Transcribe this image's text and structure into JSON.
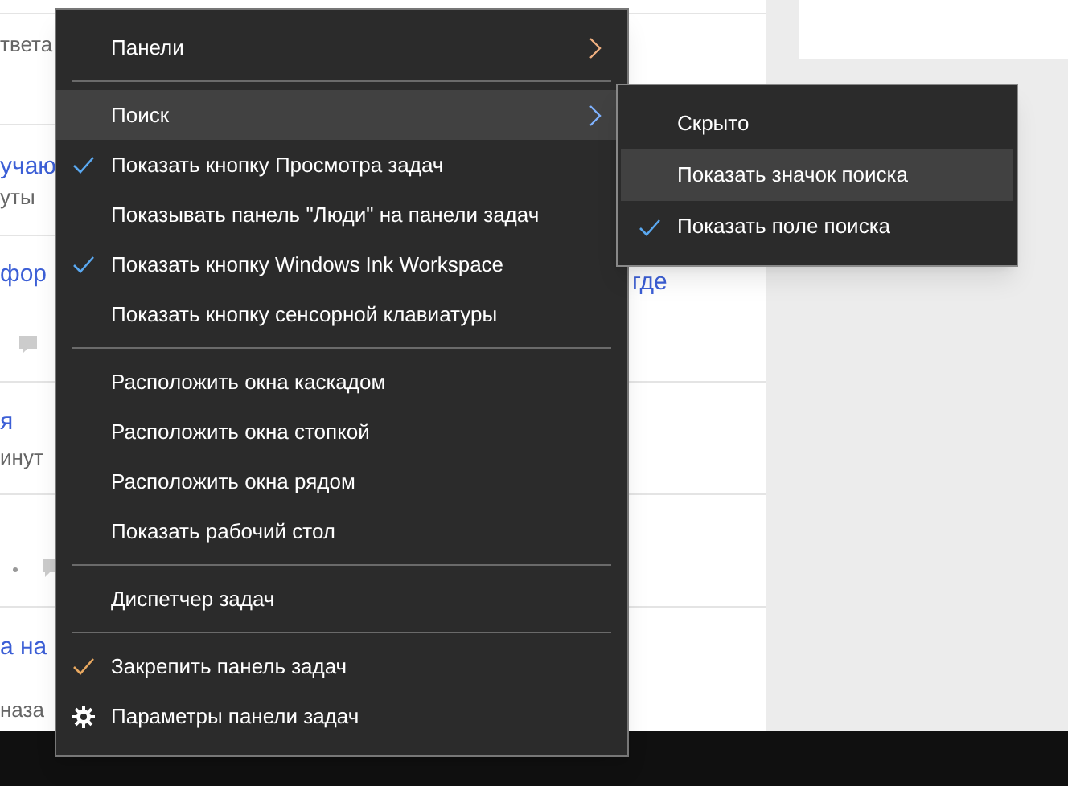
{
  "background": {
    "fragments": [
      {
        "text": "твета",
        "kind": "meta"
      },
      {
        "text": "учаю",
        "kind": "link"
      },
      {
        "text": "уты",
        "kind": "meta"
      },
      {
        "text": "фор",
        "kind": "link"
      },
      {
        "text": "где",
        "kind": "link-right"
      },
      {
        "text": "я",
        "kind": "link"
      },
      {
        "text": "инут",
        "kind": "meta"
      },
      {
        "text": "а на",
        "kind": "link"
      },
      {
        "text": "наза",
        "kind": "meta"
      }
    ]
  },
  "menu": {
    "items": [
      {
        "kind": "submenu",
        "label": "Панели",
        "checked": false,
        "selected": false,
        "color": "#f0b080"
      },
      {
        "kind": "separator"
      },
      {
        "kind": "submenu",
        "label": "Поиск",
        "checked": false,
        "selected": true,
        "color": "#7fb2ff"
      },
      {
        "kind": "item",
        "label": "Показать кнопку Просмотра задач",
        "checked": true,
        "selected": false,
        "color": "#5aa8f0"
      },
      {
        "kind": "item",
        "label": "Показывать панель \"Люди\" на панели задач",
        "checked": false,
        "selected": false
      },
      {
        "kind": "item",
        "label": "Показать кнопку Windows Ink Workspace",
        "checked": true,
        "selected": false,
        "color": "#5aa8f0"
      },
      {
        "kind": "item",
        "label": "Показать кнопку сенсорной клавиатуры",
        "checked": false,
        "selected": false
      },
      {
        "kind": "separator"
      },
      {
        "kind": "item",
        "label": "Расположить окна каскадом",
        "checked": false,
        "selected": false
      },
      {
        "kind": "item",
        "label": "Расположить окна стопкой",
        "checked": false,
        "selected": false
      },
      {
        "kind": "item",
        "label": "Расположить окна рядом",
        "checked": false,
        "selected": false
      },
      {
        "kind": "item",
        "label": "Показать рабочий стол",
        "checked": false,
        "selected": false
      },
      {
        "kind": "separator"
      },
      {
        "kind": "item",
        "label": "Диспетчер задач",
        "checked": false,
        "selected": false
      },
      {
        "kind": "separator"
      },
      {
        "kind": "item",
        "label": "Закрепить панель задач",
        "checked": true,
        "selected": false,
        "color": "#e8a860"
      },
      {
        "kind": "settings",
        "label": "Параметры панели задач",
        "checked": false,
        "selected": false
      }
    ]
  },
  "submenu": {
    "items": [
      {
        "label": "Скрыто",
        "checked": false,
        "selected": false
      },
      {
        "label": "Показать значок поиска",
        "checked": false,
        "selected": true
      },
      {
        "label": "Показать поле поиска",
        "checked": true,
        "selected": false
      }
    ]
  }
}
